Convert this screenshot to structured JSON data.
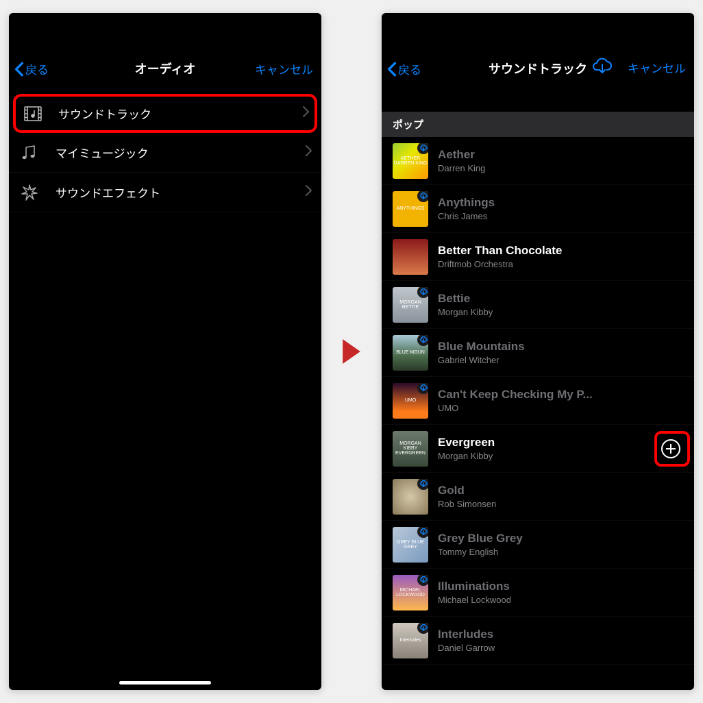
{
  "left": {
    "back": "戻る",
    "title": "オーディオ",
    "cancel": "キャンセル",
    "items": [
      {
        "label": "サウンドトラック",
        "icon": "film-music-icon"
      },
      {
        "label": "マイミュージック",
        "icon": "music-note-icon"
      },
      {
        "label": "サウンドエフェクト",
        "icon": "burst-icon"
      }
    ]
  },
  "right": {
    "back": "戻る",
    "title": "サウンドトラック",
    "cancel": "キャンセル",
    "section": "ポップ",
    "tracks": [
      {
        "title": "Aether",
        "artist": "Darren King",
        "art_bg": "linear-gradient(135deg,#9acd32,#e6e600 40%,#ff9a00)",
        "art_text": "AETHER DARREN KING",
        "dimmed": true,
        "cloud": true
      },
      {
        "title": "Anythings",
        "artist": "Chris James",
        "art_bg": "#f2b200",
        "art_text": "ANYTHINGS",
        "dimmed": true,
        "cloud": true
      },
      {
        "title": "Better Than Chocolate",
        "artist": "Driftmob Orchestra",
        "art_bg": "linear-gradient(180deg,#8b1a1a,#d97a4a)",
        "art_text": "",
        "dimmed": false,
        "cloud": false
      },
      {
        "title": "Bettie",
        "artist": "Morgan Kibby",
        "art_bg": "linear-gradient(180deg,#bfc6cc,#8a939b)",
        "art_text": "MORGAN BETTIE",
        "dimmed": true,
        "cloud": true
      },
      {
        "title": "Blue Mountains",
        "artist": "Gabriel Witcher",
        "art_bg": "linear-gradient(180deg,#a8c8d8,#4a6b4a 60%,#2a3a2a)",
        "art_text": "BLUE MOUN",
        "dimmed": true,
        "cloud": true
      },
      {
        "title": "Can't Keep Checking My P...",
        "artist": "UMO",
        "art_bg": "linear-gradient(180deg,#2a0a2a,#ff7a1a 80%)",
        "art_text": "UMO",
        "dimmed": true,
        "cloud": true
      },
      {
        "title": "Evergreen",
        "artist": "Morgan Kibby",
        "art_bg": "linear-gradient(180deg,#6b7a6b,#3a4a3a)",
        "art_text": "MORGAN KIBBY EVERGREEN",
        "dimmed": false,
        "cloud": false,
        "show_add": true
      },
      {
        "title": "Gold",
        "artist": "Rob Simonsen",
        "art_bg": "radial-gradient(circle,#d4c8a8,#8a7a5a)",
        "art_text": "",
        "dimmed": true,
        "cloud": true
      },
      {
        "title": "Grey Blue Grey",
        "artist": "Tommy English",
        "art_bg": "linear-gradient(135deg,#b8c8d8,#7a9abf)",
        "art_text": "GREY BLUE GREY",
        "dimmed": true,
        "cloud": true
      },
      {
        "title": "Illuminations",
        "artist": "Michael Lockwood",
        "art_bg": "linear-gradient(180deg,#9a5abf,#ffb84a)",
        "art_text": "MICHAEL LOCKWOOD",
        "dimmed": true,
        "cloud": true
      },
      {
        "title": "Interludes",
        "artist": "Daniel Garrow",
        "art_bg": "linear-gradient(180deg,#cfc8bf,#8a8278)",
        "art_text": "Interludes",
        "dimmed": true,
        "cloud": true
      }
    ]
  }
}
